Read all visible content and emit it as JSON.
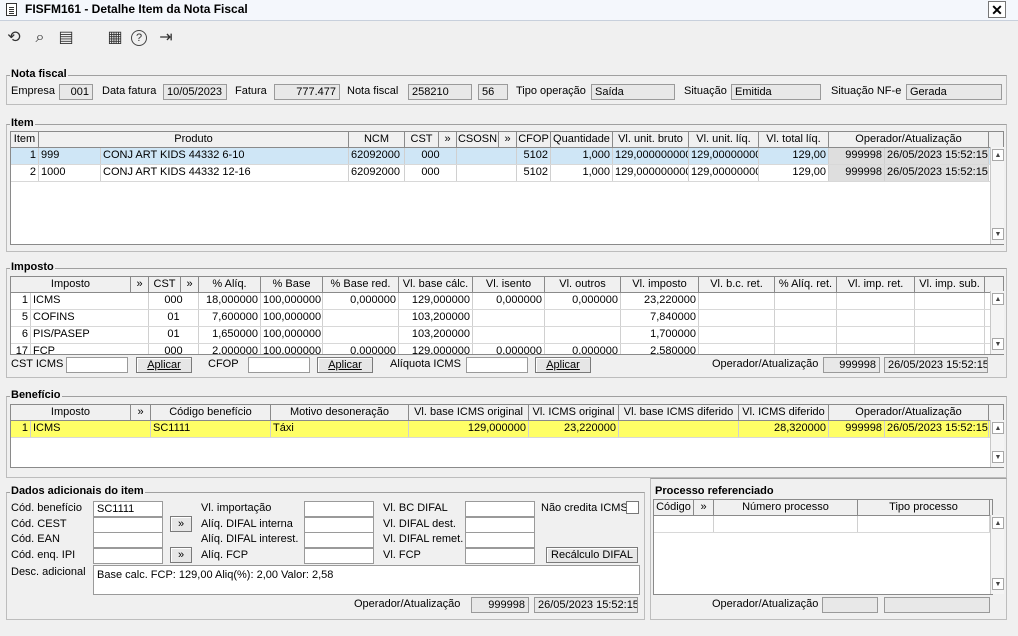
{
  "window": {
    "title": "FISFM161 - Detalhe Item da Nota Fiscal",
    "close": "✕"
  },
  "toolbar": {
    "refresh": "⟲",
    "search": "⌕",
    "save": "▤",
    "calendar": "▦",
    "help": "?",
    "exit": "⇥"
  },
  "nota": {
    "title": "Nota fiscal",
    "empresa_label": "Empresa",
    "empresa": "001",
    "data_label": "Data fatura",
    "data": "10/05/2023",
    "fatura_label": "Fatura",
    "fatura": "777.477",
    "nota_label": "Nota fiscal",
    "nota": "258210",
    "serie": "56",
    "tipo_label": "Tipo operação",
    "tipo": "Saída",
    "situacao_label": "Situação",
    "situacao": "Emitida",
    "nfe_label": "Situação NF-e",
    "nfe": "Gerada"
  },
  "item": {
    "title": "Item",
    "headers": [
      "Item",
      "Produto",
      "NCM",
      "CST",
      "»",
      "CSOSN",
      "»",
      "CFOP",
      "Quantidade",
      "Vl. unit. bruto",
      "Vl. unit. líq.",
      "Vl. total líq.",
      "Operador/Atualização"
    ],
    "rows": [
      [
        "1",
        "999",
        "CONJ ART KIDS 44332 6-10",
        "62092000",
        "000",
        "",
        "",
        "5102",
        "1,000",
        "129,000000000",
        "129,00000000",
        "129,00",
        "999998",
        "26/05/2023 15:52:15"
      ],
      [
        "2",
        "1000",
        "CONJ ART KIDS 44332 12-16",
        "62092000",
        "000",
        "",
        "",
        "5102",
        "1,000",
        "129,000000000",
        "129,00000000",
        "129,00",
        "999998",
        "26/05/2023 15:52:15"
      ]
    ]
  },
  "imposto": {
    "title": "Imposto",
    "headers": [
      "Imposto",
      "»",
      "CST",
      "»",
      "% Alíq.",
      "% Base",
      "% Base red.",
      "Vl. base cálc.",
      "Vl. isento",
      "Vl. outros",
      "Vl. imposto",
      "Vl. b.c. ret.",
      "% Alíq. ret.",
      "Vl. imp. ret.",
      "Vl. imp. sub."
    ],
    "rows": [
      [
        "1",
        "ICMS",
        "000",
        "18,000000",
        "100,000000",
        "0,000000",
        "129,000000",
        "0,000000",
        "0,000000",
        "23,220000"
      ],
      [
        "5",
        "COFINS",
        "01",
        "7,600000",
        "100,000000",
        "",
        "103,200000",
        "",
        "",
        "7,840000"
      ],
      [
        "6",
        "PIS/PASEP",
        "01",
        "1,650000",
        "100,000000",
        "",
        "103,200000",
        "",
        "",
        "1,700000"
      ],
      [
        "17",
        "FCP",
        "000",
        "2,000000",
        "100,000000",
        "0,000000",
        "129,000000",
        "0,000000",
        "0,000000",
        "2,580000"
      ]
    ],
    "cst_label": "CST ICMS",
    "cfop_label": "CFOP",
    "aliq_label": "Alíquota ICMS",
    "aplicar1": "Aplicar",
    "aplicar2": "Aplicar",
    "aplicar3": "Aplicar",
    "op_label": "Operador/Atualização",
    "op": "999998",
    "op_date": "26/05/2023 15:52:15"
  },
  "beneficio": {
    "title": "Benefício",
    "headers": [
      "Imposto",
      "»",
      "Código benefício",
      "Motivo desoneração",
      "Vl. base ICMS original",
      "Vl. ICMS original",
      "Vl. base ICMS diferido",
      "Vl. ICMS diferido",
      "Operador/Atualização"
    ],
    "rows": [
      [
        "1",
        "ICMS",
        "SC1111",
        "Táxi",
        "129,000000",
        "23,220000",
        "",
        "28,320000",
        "999998",
        "26/05/2023 15:52:15"
      ]
    ]
  },
  "dados": {
    "title": "Dados adicionais do item",
    "cod_beneficio_label": "Cód. benefício",
    "cod_beneficio": "SC1111",
    "cest_label": "Cód. CEST",
    "ean_label": "Cód. EAN",
    "enq_label": "Cód. enq. IPI",
    "desc_label": "Desc. adicional",
    "desc": "Base calc. FCP: 129,00 Aliq(%): 2,00 Valor: 2,58",
    "vl_importacao_label": "Vl. importação",
    "difal_interna_label": "Alíq. DIFAL interna",
    "difal_interest_label": "Alíq. DIFAL interest.",
    "fcp_label": "Alíq. FCP",
    "bc_difal_label": "Vl. BC DIFAL",
    "difal_dest_label": "Vl. DIFAL dest.",
    "difal_remet_label": "Vl. DIFAL remet.",
    "vl_fcp_label": "Vl. FCP",
    "nao_credita_label": "Não credita ICMS",
    "recalculo": "Recálculo DIFAL",
    "op_label": "Operador/Atualização",
    "op": "999998",
    "op_date": "26/05/2023 15:52:15"
  },
  "processo": {
    "title": "Processo referenciado",
    "headers": [
      "Código",
      "»",
      "Número processo",
      "Tipo processo"
    ],
    "op_label": "Operador/Atualização"
  }
}
